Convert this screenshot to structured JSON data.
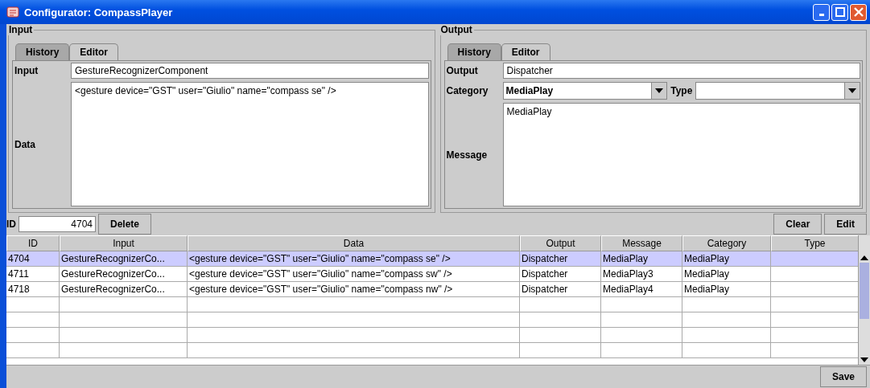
{
  "window": {
    "title": "Configurator: CompassPlayer"
  },
  "input_panel": {
    "legend": "Input",
    "tabs": [
      {
        "label": "History",
        "selected": false
      },
      {
        "label": "Editor",
        "selected": true
      }
    ],
    "input_label": "Input",
    "input_value": "GestureRecognizerComponent",
    "data_label": "Data",
    "data_value": "<gesture device=\"GST\" user=\"Giulio\" name=\"compass se\" />"
  },
  "output_panel": {
    "legend": "Output",
    "tabs": [
      {
        "label": "History",
        "selected": false
      },
      {
        "label": "Editor",
        "selected": true
      }
    ],
    "output_label": "Output",
    "output_value": "Dispatcher",
    "category_label": "Category",
    "category_value": "MediaPlay",
    "type_label": "Type",
    "message_label": "Message",
    "message_value": "MediaPlay"
  },
  "id_label": "ID",
  "id_value": "4704",
  "delete_button": "Delete",
  "clear_button": "Clear",
  "edit_button": "Edit",
  "table": {
    "columns": [
      "ID",
      "Input",
      "Data",
      "Output",
      "Message",
      "Category",
      "Type"
    ],
    "rows": [
      {
        "cells": [
          "4704",
          "GestureRecognizerCo...",
          "<gesture device=\"GST\" user=\"Giulio\" name=\"compass se\" />",
          "Dispatcher",
          "MediaPlay",
          "MediaPlay"
        ],
        "selected": true
      },
      {
        "cells": [
          "4711",
          "GestureRecognizerCo...",
          "<gesture device=\"GST\" user=\"Giulio\" name=\"compass sw\" />",
          "Dispatcher",
          "MediaPlay3",
          "MediaPlay"
        ],
        "selected": false
      },
      {
        "cells": [
          "4718",
          "GestureRecognizerCo...",
          "<gesture device=\"GST\" user=\"Giulio\" name=\"compass nw\" />",
          "Dispatcher",
          "MediaPlay4",
          "MediaPlay"
        ],
        "selected": false
      }
    ]
  },
  "save_button": "Save"
}
